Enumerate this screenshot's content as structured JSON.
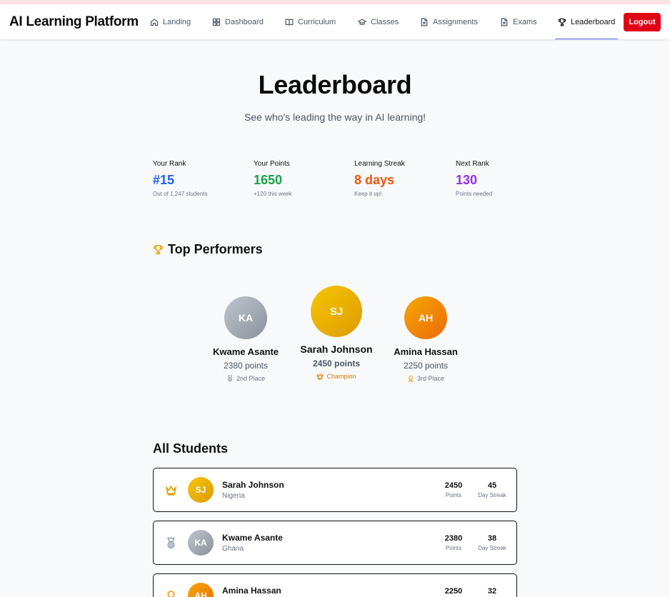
{
  "app": {
    "brand": "AI Learning Platform"
  },
  "nav": {
    "items": [
      {
        "label": "Landing",
        "icon": "home-icon"
      },
      {
        "label": "Dashboard",
        "icon": "dashboard-icon"
      },
      {
        "label": "Curriculum",
        "icon": "book-icon"
      },
      {
        "label": "Classes",
        "icon": "graduation-cap-icon"
      },
      {
        "label": "Assignments",
        "icon": "file-icon"
      },
      {
        "label": "Exams",
        "icon": "file-text-icon"
      },
      {
        "label": "Leaderboard",
        "icon": "trophy-icon",
        "active": true
      }
    ],
    "logout_label": "Logout"
  },
  "header": {
    "title": "Leaderboard",
    "subtitle": "See who's leading the way in AI learning!"
  },
  "stats": [
    {
      "label": "Your Rank",
      "value": "#15",
      "note": "Out of 1,247 students",
      "color": "#1d5ef5"
    },
    {
      "label": "Your Points",
      "value": "1650",
      "note": "+120 this week",
      "color": "#16a34a"
    },
    {
      "label": "Learning Streak",
      "value": "8 days",
      "note": "Keep it up!",
      "color": "#ea580c"
    },
    {
      "label": "Next Rank",
      "value": "130",
      "note": "Points needed",
      "color": "#9333ea"
    }
  ],
  "top_performers": {
    "title": "Top Performers",
    "first": {
      "initials": "SJ",
      "name": "Sarah Johnson",
      "points": "2450 points",
      "place": "Champion",
      "icon": "crown-icon"
    },
    "second": {
      "initials": "KA",
      "name": "Kwame Asante",
      "points": "2380 points",
      "place": "2nd Place",
      "icon": "medal-icon"
    },
    "third": {
      "initials": "AH",
      "name": "Amina Hassan",
      "points": "2250 points",
      "place": "3rd Place",
      "icon": "award-icon"
    }
  },
  "all_students": {
    "title": "All Students",
    "points_label": "Points",
    "streak_label": "Day Streak",
    "rows": [
      {
        "initials": "SJ",
        "name": "Sarah Johnson",
        "country": "Nigeria",
        "points": "2450",
        "streak": "45",
        "icon": "crown-icon"
      },
      {
        "initials": "KA",
        "name": "Kwame Asante",
        "country": "Ghana",
        "points": "2380",
        "streak": "38",
        "icon": "medal-icon"
      },
      {
        "initials": "AH",
        "name": "Amina Hassan",
        "country": "",
        "points": "2250",
        "streak": "32",
        "icon": "award-icon"
      }
    ]
  },
  "colors": {
    "logout": "#e00016",
    "gold": "#f7c600",
    "silver": "#9ca3af",
    "bronze": "#f59e0b"
  }
}
